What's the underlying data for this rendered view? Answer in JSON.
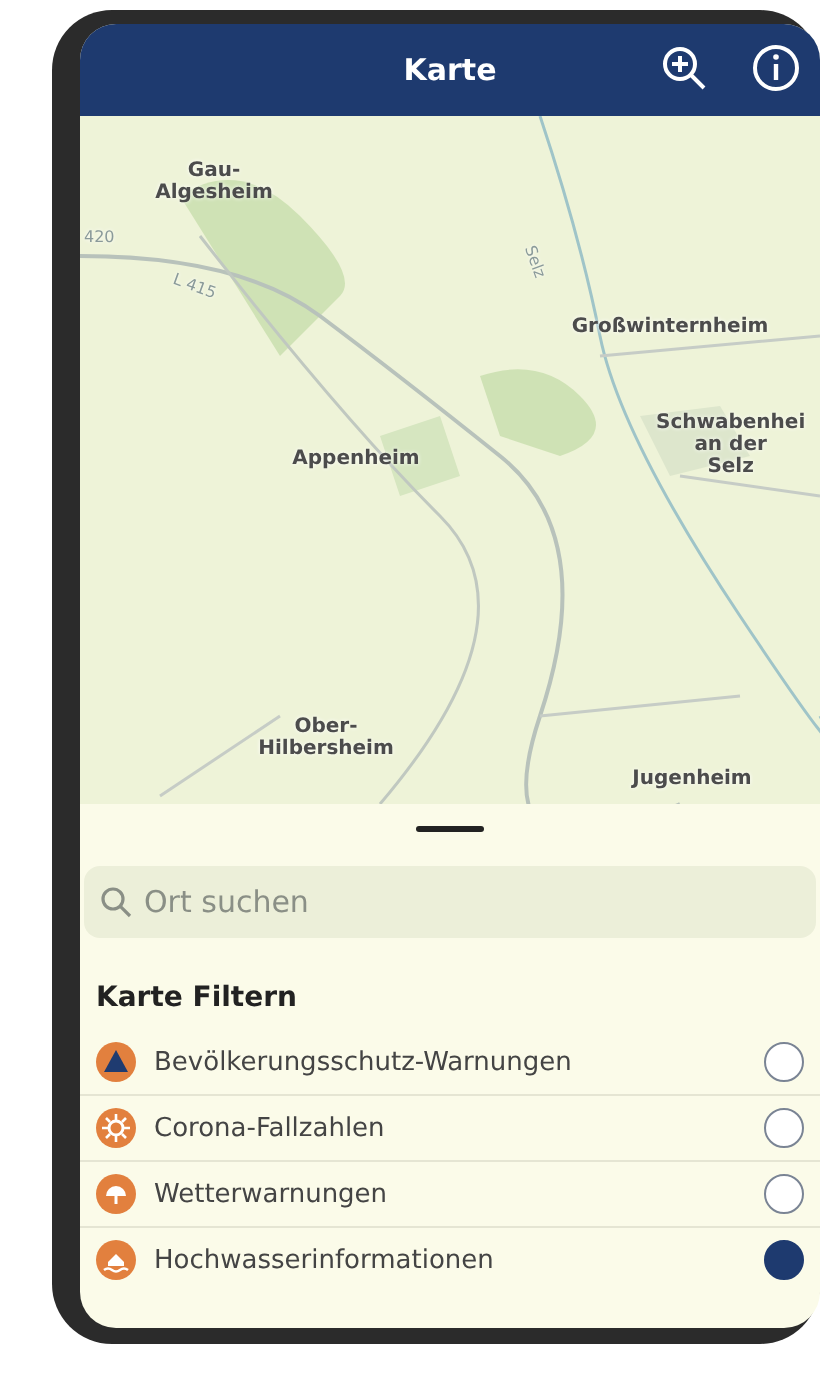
{
  "header": {
    "title": "Karte"
  },
  "map": {
    "labels": [
      {
        "text": "Gau-\nAlgesheim",
        "kind": "place"
      },
      {
        "text": "420",
        "kind": "road"
      },
      {
        "text": "L 415",
        "kind": "road"
      },
      {
        "text": "Selz",
        "kind": "river"
      },
      {
        "text": "Großwinternheim",
        "kind": "place"
      },
      {
        "text": "Appenheim",
        "kind": "place"
      },
      {
        "text": "Schwabenhei\nan der\nSelz",
        "kind": "place"
      },
      {
        "text": "Ober-\nHilbersheim",
        "kind": "place"
      },
      {
        "text": "Jugenheim",
        "kind": "place"
      }
    ]
  },
  "sheet": {
    "search": {
      "placeholder": "Ort suchen"
    },
    "heading": "Karte Filtern",
    "filters": [
      {
        "label": "Bevölkerungsschutz-Warnungen",
        "kind": "civil",
        "checked": false
      },
      {
        "label": "Corona-Fallzahlen",
        "kind": "virus",
        "checked": false
      },
      {
        "label": "Wetterwarnungen",
        "kind": "weather",
        "checked": false
      },
      {
        "label": "Hochwasserinformationen",
        "kind": "flood",
        "checked": true
      }
    ]
  }
}
